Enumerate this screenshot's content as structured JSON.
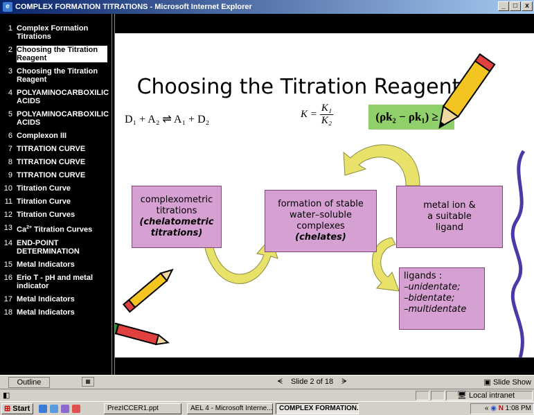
{
  "window": {
    "title": "COMPLEX FORMATION TITRATIONS - Microsoft Internet Explorer",
    "minimize": "_",
    "maximize": "□",
    "close": "x"
  },
  "outline": {
    "items": [
      {
        "num": "1",
        "label": "Complex Formation Titrations"
      },
      {
        "num": "2",
        "label": "Choosing the Titration Reagent",
        "selected": true
      },
      {
        "num": "3",
        "label": "Choosing the Titration Reagent"
      },
      {
        "num": "4",
        "label": "POLYAMINOCARBOXILIC ACIDS"
      },
      {
        "num": "5",
        "label": "POLYAMINOCARBOXILIC ACIDS"
      },
      {
        "num": "6",
        "label": "Complexon III"
      },
      {
        "num": "7",
        "label": "TITRATION CURVE"
      },
      {
        "num": "8",
        "label": "TITRATION CURVE"
      },
      {
        "num": "9",
        "label": "TITRATION CURVE"
      },
      {
        "num": "10",
        "label": "Titration Curve"
      },
      {
        "num": "11",
        "label": "Titration Curve"
      },
      {
        "num": "12",
        "label": "Titration Curves"
      },
      {
        "num": "13",
        "label_pre": "Ca",
        "label_sup": "2+",
        "label_post": " Titration Curves"
      },
      {
        "num": "14",
        "label": "END-POINT DETERMINATION"
      },
      {
        "num": "15",
        "label": "Metal Indicators"
      },
      {
        "num": "16",
        "label": "Erio T - pH and metal indicator"
      },
      {
        "num": "17",
        "label": "Metal Indicators"
      },
      {
        "num": "18",
        "label": "Metal Indicators"
      }
    ]
  },
  "slide": {
    "title": "Choosing the Titration Reagent",
    "reaction": "D₁ + A₂ ⇌ A₁ + D₂",
    "k_label": "K =",
    "k_num": "K₁",
    "k_den": "K₂",
    "condition": "(ρk₂ − ρk₁) ≥ 6",
    "box1_line1": "complexometric",
    "box1_line2": "titrations",
    "box1_line3": "(chelatometric",
    "box1_line4": "titrations)",
    "box2_line1": "formation of stable",
    "box2_line2": "water–soluble",
    "box2_line3": "complexes",
    "box2_line4": "(chelates)",
    "box3_line1": "metal ion &",
    "box3_line2": "a suitable",
    "box3_line3": "ligand",
    "lig_title": "ligands :",
    "lig1": "–unidentate;",
    "lig2": "–bidentate;",
    "lig3": "–multidentate"
  },
  "bottombar": {
    "outline_label": "Outline",
    "prev": "ᗕ",
    "slide_counter": "Slide 2 of 18",
    "next": "ᗒ",
    "slideshow_label": "Slide Show"
  },
  "statusbar": {
    "zone": "Local intranet"
  },
  "taskbar": {
    "start": "Start",
    "items": [
      "PrezICCER1.ppt",
      "AEL 4 - Microsoft Interne...",
      "COMPLEX FORMATION..."
    ],
    "clock": "1:08 PM"
  },
  "colors": {
    "box_fill": "#d7a0d3",
    "green_box": "#8fd06a",
    "arrow": "#e8e26a"
  }
}
